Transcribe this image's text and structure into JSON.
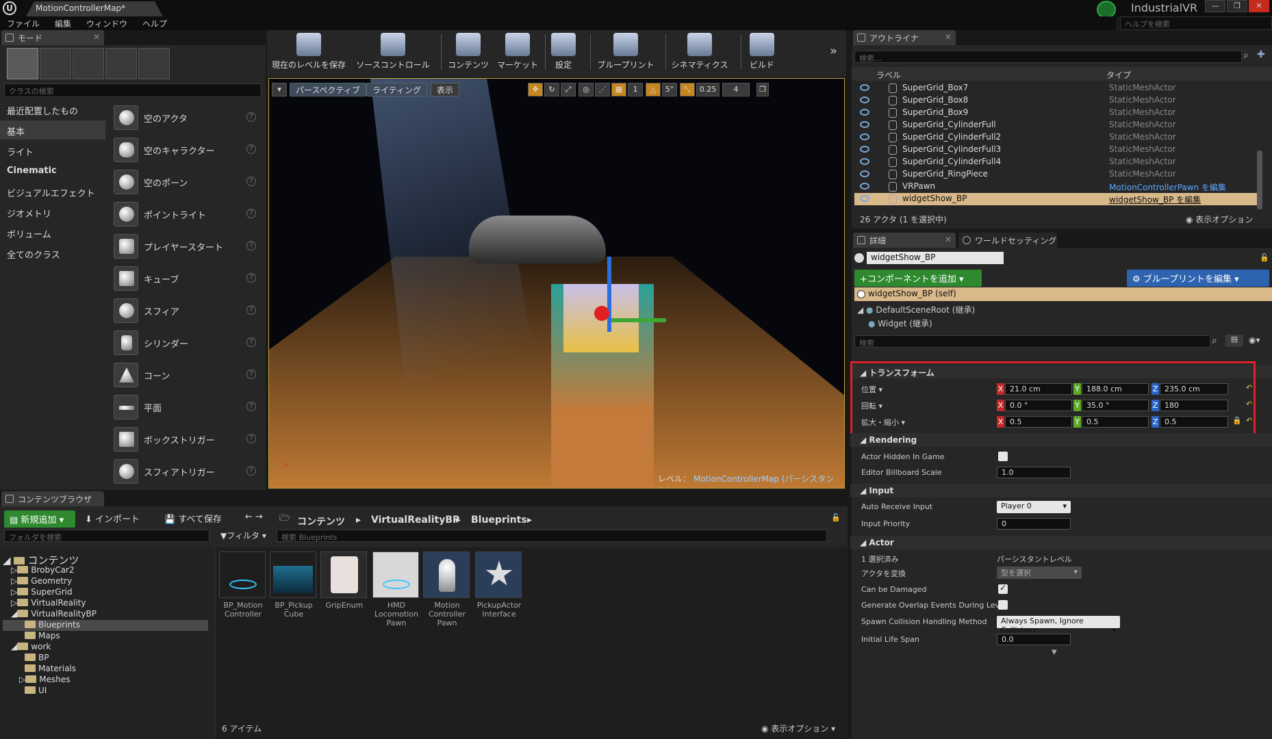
{
  "titlebar": {
    "tab_title": "MotionControllerMap*",
    "brand": "IndustrialVR",
    "help_search_placeholder": "ヘルプを検索",
    "minimize": "—",
    "maximize": "❐",
    "close": "✕"
  },
  "menu": [
    "ファイル",
    "編集",
    "ウィンドウ",
    "ヘルプ"
  ],
  "modes": {
    "tab_label": "モード",
    "class_search_placeholder": "クラスの検索",
    "categories": [
      "最近配置したもの",
      "基本",
      "ライト",
      "Cinematic",
      "ビジュアルエフェクト",
      "ジオメトリ",
      "ボリューム",
      "全てのクラス"
    ],
    "items": [
      "空のアクタ",
      "空のキャラクター",
      "空のポーン",
      "ポイントライト",
      "プレイヤースタート",
      "キューブ",
      "スフィア",
      "シリンダー",
      "コーン",
      "平面",
      "ボックストリガー",
      "スフィアトリガー"
    ]
  },
  "toolbar": [
    "現在のレベルを保存",
    "ソースコントロール",
    "コンテンツ",
    "マーケット",
    "設定",
    "ブループリント",
    "シネマティクス",
    "ビルド"
  ],
  "viewport": {
    "perspective": "パースペクティブ",
    "lighting": "ライティング",
    "show": "表示",
    "snap_angle": "5°",
    "scale_snap": "0.25",
    "cam_speed": "4",
    "level_label": "レベル：",
    "level_name": "MotionControllerMap (パーシスタント)"
  },
  "outliner": {
    "tab_label": "アウトライナ",
    "search_placeholder": "検索...",
    "col_label": "ラベル",
    "col_type": "タイプ",
    "rows": [
      {
        "name": "SuperGrid_Box7",
        "type": "StaticMeshActor"
      },
      {
        "name": "SuperGrid_Box8",
        "type": "StaticMeshActor"
      },
      {
        "name": "SuperGrid_Box9",
        "type": "StaticMeshActor"
      },
      {
        "name": "SuperGrid_CylinderFull",
        "type": "StaticMeshActor"
      },
      {
        "name": "SuperGrid_CylinderFull2",
        "type": "StaticMeshActor"
      },
      {
        "name": "SuperGrid_CylinderFull3",
        "type": "StaticMeshActor"
      },
      {
        "name": "SuperGrid_CylinderFull4",
        "type": "StaticMeshActor"
      },
      {
        "name": "SuperGrid_RingPiece",
        "type": "StaticMeshActor"
      },
      {
        "name": "VRPawn",
        "type": "MotionControllerPawn を編集"
      },
      {
        "name": "widgetShow_BP",
        "type": "widgetShow_BP を編集"
      }
    ],
    "count": "26 アクタ (1 を選択中)",
    "view_options": "表示オプション"
  },
  "details": {
    "tab_label": "詳細",
    "world_tab": "ワールドセッティング",
    "actor_name": "widgetShow_BP",
    "add_component": "+コンポーネントを追加",
    "edit_blueprint": "ブループリントを編集",
    "self_label": "widgetShow_BP (self)",
    "comp_root": "DefaultSceneRoot (継承)",
    "comp_widget": "Widget (継承)",
    "search_placeholder": "検索",
    "transform": {
      "header": "トランスフォーム",
      "location_label": "位置",
      "rotation_label": "回転",
      "scale_label": "拡大・縮小",
      "location": [
        "21.0 cm",
        "188.0 cm",
        "235.0 cm"
      ],
      "rotation": [
        "0.0 °",
        "35.0 °",
        "180"
      ],
      "scale": [
        "0.5",
        "0.5",
        "0.5"
      ]
    },
    "rendering": {
      "header": "Rendering",
      "hidden_label": "Actor Hidden In Game",
      "billboard_label": "Editor Billboard Scale",
      "billboard_value": "1.0"
    },
    "input": {
      "header": "Input",
      "auto_label": "Auto Receive Input",
      "auto_value": "Player 0",
      "priority_label": "Input Priority",
      "priority_value": "0"
    },
    "actor": {
      "header": "Actor",
      "selected_label": "1 選択済み",
      "selected_value": "パーシスタントレベル",
      "convert_label": "アクタを変換",
      "convert_value": "型を選択",
      "damaged_label": "Can be Damaged",
      "overlap_label": "Generate Overlap Events During Level",
      "spawn_label": "Spawn Collision Handling Method",
      "spawn_value": "Always Spawn, Ignore Collisions",
      "life_label": "Initial Life Span",
      "life_value": "0.0"
    }
  },
  "content_browser": {
    "tab_label": "コンテンツブラウザ",
    "add_new": "新規追加",
    "import": "インポート",
    "save_all": "すべて保存",
    "breadcrumb": [
      "コンテンツ",
      "VirtualRealityBP",
      "Blueprints"
    ],
    "folder_search_placeholder": "フォルダを検索",
    "filter": "フィルタ",
    "asset_search_placeholder": "検索 Blueprints",
    "tree": [
      {
        "label": "コンテンツ",
        "depth": 0
      },
      {
        "label": "BrobyCar2",
        "depth": 1
      },
      {
        "label": "Geometry",
        "depth": 1
      },
      {
        "label": "SuperGrid",
        "depth": 1
      },
      {
        "label": "VirtualReality",
        "depth": 1
      },
      {
        "label": "VirtualRealityBP",
        "depth": 1
      },
      {
        "label": "Blueprints",
        "depth": 2
      },
      {
        "label": "Maps",
        "depth": 2
      },
      {
        "label": "work",
        "depth": 1
      },
      {
        "label": "BP",
        "depth": 2
      },
      {
        "label": "Materials",
        "depth": 2
      },
      {
        "label": "Meshes",
        "depth": 2
      },
      {
        "label": "UI",
        "depth": 2
      }
    ],
    "assets": [
      {
        "line1": "BP_Motion",
        "line2": "Controller",
        "line3": ""
      },
      {
        "line1": "BP_Pickup",
        "line2": "Cube",
        "line3": ""
      },
      {
        "line1": "GripEnum",
        "line2": "",
        "line3": ""
      },
      {
        "line1": "HMD",
        "line2": "Locomotion",
        "line3": "Pawn"
      },
      {
        "line1": "Motion",
        "line2": "Controller",
        "line3": "Pawn"
      },
      {
        "line1": "PickupActor",
        "line2": "Interface",
        "line3": ""
      }
    ],
    "item_count": "6 アイテム",
    "view_options": "表示オプション"
  },
  "colors": {
    "highlight_border": "#e0202a",
    "selection": "#d9b98a",
    "add_green": "#2f8a2f",
    "edit_blue": "#2e63b0"
  }
}
